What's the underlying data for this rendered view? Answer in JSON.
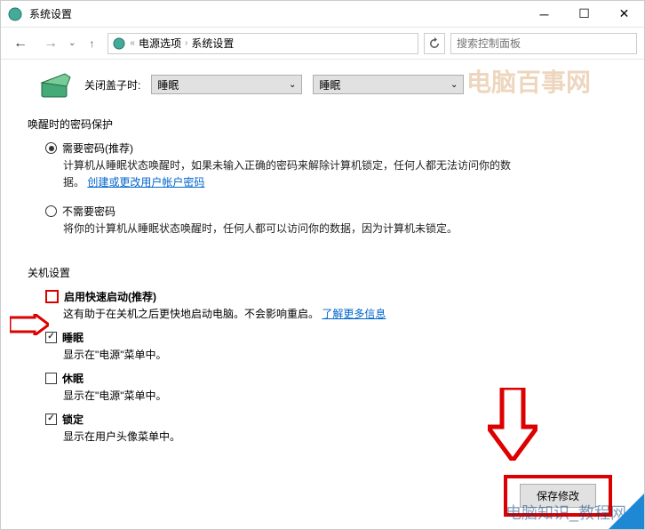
{
  "window": {
    "title": "系统设置"
  },
  "breadcrumb": {
    "level1": "电源选项",
    "level2": "系统设置"
  },
  "search": {
    "placeholder": "搜索控制面板"
  },
  "lid": {
    "label": "关闭盖子时:",
    "battery": "睡眠",
    "plugged": "睡眠"
  },
  "section_password": {
    "title": "唤醒时的密码保护"
  },
  "radio_need": {
    "label": "需要密码(推荐)",
    "desc_a": "计算机从睡眠状态唤醒时，如果未输入正确的密码来解除计算机锁定，任何人都无法访问你的数",
    "desc_b": "据。",
    "link": "创建或更改用户帐户密码"
  },
  "radio_noneed": {
    "label": "不需要密码",
    "desc": "将你的计算机从睡眠状态唤醒时，任何人都可以访问你的数据，因为计算机未锁定。"
  },
  "section_shutdown": {
    "title": "关机设置"
  },
  "fast_startup": {
    "label": "启用快速启动(推荐)",
    "desc": "这有助于在关机之后更快地启动电脑。不会影响重启。",
    "link": "了解更多信息"
  },
  "sleep": {
    "label": "睡眠",
    "desc": "显示在\"电源\"菜单中。"
  },
  "hibernate": {
    "label": "休眠",
    "desc": "显示在\"电源\"菜单中。"
  },
  "lock": {
    "label": "锁定",
    "desc": "显示在用户头像菜单中。"
  },
  "buttons": {
    "save": "保存修改"
  },
  "watermark": {
    "top": "电脑百事网",
    "bottom": "电脑知识_教程网"
  }
}
